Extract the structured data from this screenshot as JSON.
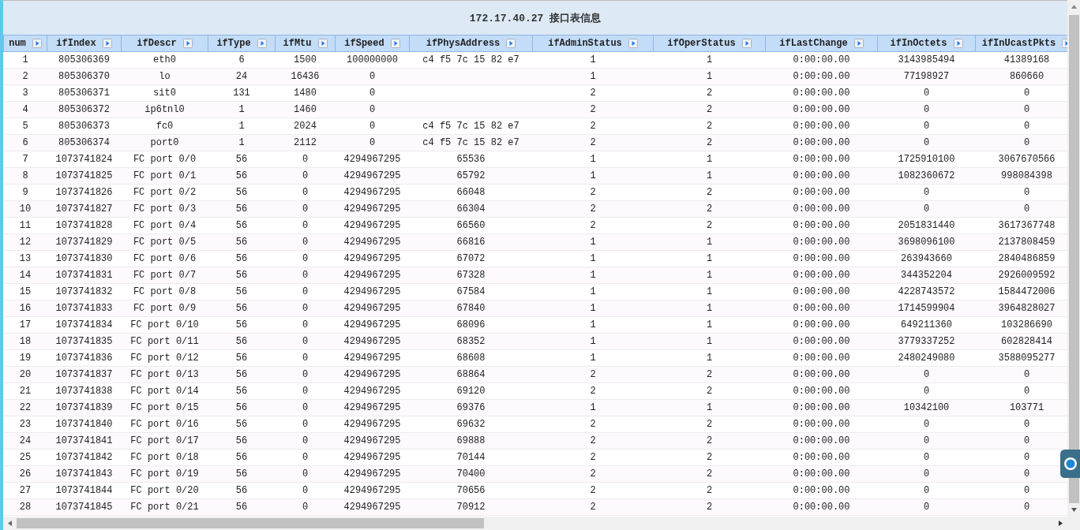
{
  "title": "172.17.40.27 接口表信息",
  "table": {
    "columns": [
      "num",
      "ifIndex",
      "ifDescr",
      "ifType",
      "ifMtu",
      "ifSpeed",
      "ifPhysAddress",
      "ifAdminStatus",
      "ifOperStatus",
      "ifLastChange",
      "ifInOctets",
      "ifInUcastPkts"
    ],
    "rows": [
      [
        "1",
        "805306369",
        "eth0",
        "6",
        "1500",
        "100000000",
        "c4 f5 7c 15 82 e7",
        "1",
        "1",
        "0:00:00.00",
        "3143985494",
        "41389168"
      ],
      [
        "2",
        "805306370",
        "lo",
        "24",
        "16436",
        "0",
        null,
        "1",
        "1",
        "0:00:00.00",
        "77198927",
        "860660"
      ],
      [
        "3",
        "805306371",
        "sit0",
        "131",
        "1480",
        "0",
        null,
        "2",
        "2",
        "0:00:00.00",
        "0",
        "0"
      ],
      [
        "4",
        "805306372",
        "ip6tnl0",
        "1",
        "1460",
        "0",
        null,
        "2",
        "2",
        "0:00:00.00",
        "0",
        "0"
      ],
      [
        "5",
        "805306373",
        "fc0",
        "1",
        "2024",
        "0",
        "c4 f5 7c 15 82 e7",
        "2",
        "2",
        "0:00:00.00",
        "0",
        "0"
      ],
      [
        "6",
        "805306374",
        "port0",
        "1",
        "2112",
        "0",
        "c4 f5 7c 15 82 e7",
        "2",
        "2",
        "0:00:00.00",
        "0",
        "0"
      ],
      [
        "7",
        "1073741824",
        "FC port 0/0",
        "56",
        "0",
        "4294967295",
        "65536",
        "1",
        "1",
        "0:00:00.00",
        "1725910100",
        "3067670566"
      ],
      [
        "8",
        "1073741825",
        "FC port 0/1",
        "56",
        "0",
        "4294967295",
        "65792",
        "1",
        "1",
        "0:00:00.00",
        "1082360672",
        "998084398"
      ],
      [
        "9",
        "1073741826",
        "FC port 0/2",
        "56",
        "0",
        "4294967295",
        "66048",
        "2",
        "2",
        "0:00:00.00",
        "0",
        "0"
      ],
      [
        "10",
        "1073741827",
        "FC port 0/3",
        "56",
        "0",
        "4294967295",
        "66304",
        "2",
        "2",
        "0:00:00.00",
        "0",
        "0"
      ],
      [
        "11",
        "1073741828",
        "FC port 0/4",
        "56",
        "0",
        "4294967295",
        "66560",
        "2",
        "2",
        "0:00:00.00",
        "2051831440",
        "3617367748"
      ],
      [
        "12",
        "1073741829",
        "FC port 0/5",
        "56",
        "0",
        "4294967295",
        "66816",
        "1",
        "1",
        "0:00:00.00",
        "3698096100",
        "2137808459"
      ],
      [
        "13",
        "1073741830",
        "FC port 0/6",
        "56",
        "0",
        "4294967295",
        "67072",
        "1",
        "1",
        "0:00:00.00",
        "263943660",
        "2840486859"
      ],
      [
        "14",
        "1073741831",
        "FC port 0/7",
        "56",
        "0",
        "4294967295",
        "67328",
        "1",
        "1",
        "0:00:00.00",
        "344352204",
        "2926009592"
      ],
      [
        "15",
        "1073741832",
        "FC port 0/8",
        "56",
        "0",
        "4294967295",
        "67584",
        "1",
        "1",
        "0:00:00.00",
        "4228743572",
        "1584472006"
      ],
      [
        "16",
        "1073741833",
        "FC port 0/9",
        "56",
        "0",
        "4294967295",
        "67840",
        "1",
        "1",
        "0:00:00.00",
        "1714599904",
        "3964828027"
      ],
      [
        "17",
        "1073741834",
        "FC port 0/10",
        "56",
        "0",
        "4294967295",
        "68096",
        "1",
        "1",
        "0:00:00.00",
        "649211360",
        "103286690"
      ],
      [
        "18",
        "1073741835",
        "FC port 0/11",
        "56",
        "0",
        "4294967295",
        "68352",
        "1",
        "1",
        "0:00:00.00",
        "3779337252",
        "602828414"
      ],
      [
        "19",
        "1073741836",
        "FC port 0/12",
        "56",
        "0",
        "4294967295",
        "68608",
        "1",
        "1",
        "0:00:00.00",
        "2480249080",
        "3588095277"
      ],
      [
        "20",
        "1073741837",
        "FC port 0/13",
        "56",
        "0",
        "4294967295",
        "68864",
        "2",
        "2",
        "0:00:00.00",
        "0",
        "0"
      ],
      [
        "21",
        "1073741838",
        "FC port 0/14",
        "56",
        "0",
        "4294967295",
        "69120",
        "2",
        "2",
        "0:00:00.00",
        "0",
        "0"
      ],
      [
        "22",
        "1073741839",
        "FC port 0/15",
        "56",
        "0",
        "4294967295",
        "69376",
        "1",
        "1",
        "0:00:00.00",
        "10342100",
        "103771"
      ],
      [
        "23",
        "1073741840",
        "FC port 0/16",
        "56",
        "0",
        "4294967295",
        "69632",
        "2",
        "2",
        "0:00:00.00",
        "0",
        "0"
      ],
      [
        "24",
        "1073741841",
        "FC port 0/17",
        "56",
        "0",
        "4294967295",
        "69888",
        "2",
        "2",
        "0:00:00.00",
        "0",
        "0"
      ],
      [
        "25",
        "1073741842",
        "FC port 0/18",
        "56",
        "0",
        "4294967295",
        "70144",
        "2",
        "2",
        "0:00:00.00",
        "0",
        "0"
      ],
      [
        "26",
        "1073741843",
        "FC port 0/19",
        "56",
        "0",
        "4294967295",
        "70400",
        "2",
        "2",
        "0:00:00.00",
        "0",
        "0"
      ],
      [
        "27",
        "1073741844",
        "FC port 0/20",
        "56",
        "0",
        "4294967295",
        "70656",
        "2",
        "2",
        "0:00:00.00",
        "0",
        "0"
      ],
      [
        "28",
        "1073741845",
        "FC port 0/21",
        "56",
        "0",
        "4294967295",
        "70912",
        "2",
        "2",
        "0:00:00.00",
        "0",
        "0"
      ]
    ]
  }
}
